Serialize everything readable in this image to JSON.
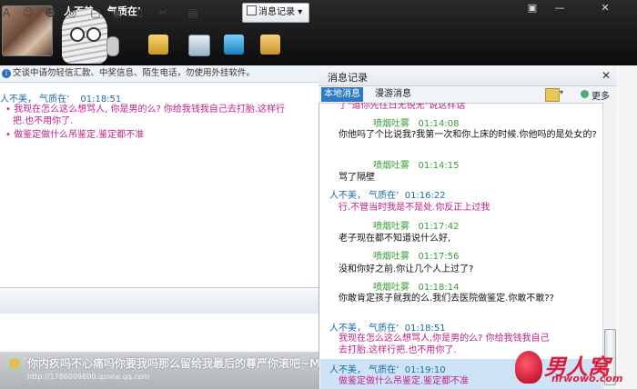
{
  "window": {
    "nickname": "人不美，  气质在’",
    "star": "★",
    "controls": [
      "▣",
      "—",
      "✕"
    ]
  },
  "notice": "交谈中请勿轻信汇款、中奖信息、陌生电话，勿使用外挂软件。",
  "chat": {
    "header_name": "人不美，  气质在’",
    "header_time": "01:18:51",
    "msg1_line1": "我现在怎么这么想骂人, 你是男的么? 你给我钱我自己去打胎.这样行",
    "msg1_line2": "把.也不用你了.",
    "msg2": "做鉴定做什么吊鉴定.鉴定都不准",
    "bullet": "•"
  },
  "toolbar": {
    "history_label": "消息记录",
    "history_arrow": "▾"
  },
  "overlay": {
    "text": "你内疚吗不心痛吗你要我吗那么留给我最后的尊严你滚吧~MR",
    "url": "http://1786009600.qzone.qq.com"
  },
  "history": {
    "title": "消息记录",
    "close": "✕",
    "tab_local": "本地消息",
    "tab_roam": "漫游消息",
    "more": "更多",
    "top_cut": "了\"道你先往日无锐无\"说这样话",
    "entries": [
      {
        "name": "喷烟吐雾",
        "time": "01:14:08",
        "msg": "你他吗了个比说我?我第一次和你上床的时候.你他吗的是处女的?"
      },
      {
        "name": "喷烟吐雾",
        "time": "01:14:15",
        "msg": "骂了隔壁"
      },
      {
        "name": "人不美，  气质在’",
        "time": "01:16:22",
        "msg": "行.不管当时我是不是处.你反正上过我"
      },
      {
        "name": "喷烟吐雾",
        "time": "01:17:42",
        "msg": "老子现在都不知道说什么好,"
      },
      {
        "name": "喷烟吐雾",
        "time": "01:17:56",
        "msg": "没和你好之前.你让几个人上过了?"
      },
      {
        "name": "喷烟吐雾",
        "time": "01:18:14",
        "msg": "你敢肯定孩子就我的么.我们去医院做鉴定.你敢不敢??"
      },
      {
        "name": "人不美，  气质在’",
        "time": "01:18:51",
        "msg": "我现在怎么这么想骂人,你是男的么? 你给我钱我自己去打胎.这样行把.也不用你了."
      },
      {
        "name": "人不美，  气质在’",
        "time": "01:19:10",
        "msg": "做鉴定做什么吊鉴定.鉴定都不准"
      }
    ]
  },
  "logo": {
    "text": "男人窝",
    "url": "nrwowo.com"
  },
  "colors": {
    "accent": "#2d7ac6",
    "pink": "#c0208a",
    "green": "#3a9a3a",
    "blue": "#1a6aa8"
  }
}
